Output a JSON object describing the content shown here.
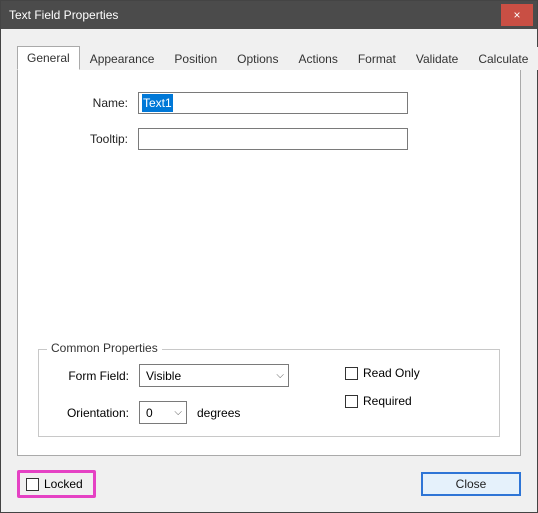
{
  "window": {
    "title": "Text Field Properties"
  },
  "tabs": [
    {
      "label": "General"
    },
    {
      "label": "Appearance"
    },
    {
      "label": "Position"
    },
    {
      "label": "Options"
    },
    {
      "label": "Actions"
    },
    {
      "label": "Format"
    },
    {
      "label": "Validate"
    },
    {
      "label": "Calculate"
    }
  ],
  "general": {
    "name_label": "Name:",
    "name_value": "Text1",
    "tooltip_label": "Tooltip:",
    "tooltip_value": ""
  },
  "common": {
    "legend": "Common Properties",
    "form_field_label": "Form Field:",
    "form_field_value": "Visible",
    "orientation_label": "Orientation:",
    "orientation_value": "0",
    "orientation_unit": "degrees",
    "read_only_label": "Read Only",
    "read_only_checked": false,
    "required_label": "Required",
    "required_checked": false
  },
  "footer": {
    "locked_label": "Locked",
    "locked_checked": false,
    "close_label": "Close"
  }
}
